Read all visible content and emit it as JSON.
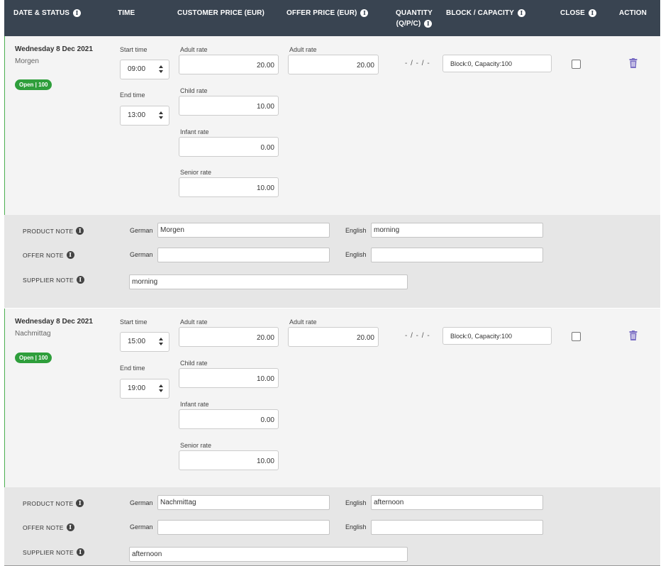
{
  "header": {
    "date_status": "DATE & STATUS",
    "time": "TIME",
    "customer_price": "CUSTOMER PRICE (EUR)",
    "offer_price": "OFFER PRICE (EUR)",
    "quantity_line1": "QUANTITY",
    "quantity_line2": "(Q/P/C)",
    "block_capacity": "BLOCK / CAPACITY",
    "close": "CLOSE",
    "action": "ACTION"
  },
  "labels": {
    "start_time": "Start time",
    "end_time": "End time",
    "adult_rate": "Adult rate",
    "child_rate": "Child rate",
    "infant_rate": "Infant rate",
    "senior_rate": "Senior rate",
    "product_note": "PRODUCT NOTE",
    "offer_note": "OFFER NOTE",
    "supplier_note": "SUPPLIER NOTE",
    "german": "German",
    "english": "English",
    "info": "i"
  },
  "slots": [
    {
      "date": "Wednesday 8 Dec 2021",
      "name": "Morgen",
      "badge": "Open | 100",
      "start_time": "09:00",
      "end_time": "13:00",
      "customer_adult": "20.00",
      "customer_child": "10.00",
      "customer_infant": "0.00",
      "customer_senior": "10.00",
      "offer_adult": "20.00",
      "quantity": "- / - / -",
      "block": "Block:0, Capacity:100",
      "product_note_de": "Morgen",
      "product_note_en": "morning",
      "offer_note_de": "",
      "offer_note_en": "",
      "supplier_note": "morning"
    },
    {
      "date": "Wednesday 8 Dec 2021",
      "name": "Nachmittag",
      "badge": "Open | 100",
      "start_time": "15:00",
      "end_time": "19:00",
      "customer_adult": "20.00",
      "customer_child": "10.00",
      "customer_infant": "0.00",
      "customer_senior": "10.00",
      "offer_adult": "20.00",
      "quantity": "- / - / -",
      "block": "Block:0, Capacity:100",
      "product_note_de": "Nachmittag",
      "product_note_en": "afternoon",
      "offer_note_de": "",
      "offer_note_en": "",
      "supplier_note": "afternoon"
    }
  ],
  "colors": {
    "header_bg": "#394451",
    "badge_green": "#2e9e3b",
    "trash_purple": "#7b6fc4",
    "slot_bg": "#f4f4f4",
    "notes_bg": "#e6e6e6"
  },
  "icons": {
    "info": "info-icon",
    "delete": "trash-icon",
    "select_arrows": "updown-arrows-icon"
  }
}
